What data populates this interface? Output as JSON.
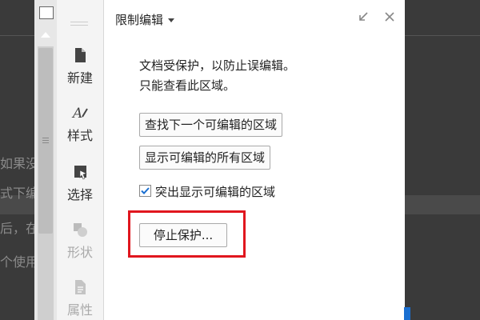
{
  "document": {
    "fragments": [
      "如果没",
      "式下编",
      "后，在",
      "个使用"
    ]
  },
  "sidebar": {
    "items": [
      {
        "label": "新建",
        "icon": "new-document-icon",
        "enabled": true
      },
      {
        "label": "样式",
        "icon": "style-icon",
        "enabled": true
      },
      {
        "label": "选择",
        "icon": "select-icon",
        "enabled": true
      },
      {
        "label": "形状",
        "icon": "shape-icon",
        "enabled": false
      },
      {
        "label": "属性",
        "icon": "properties-icon",
        "enabled": false
      }
    ]
  },
  "panel": {
    "title": "限制编辑",
    "description_line1": "文档受保护，以防止误编辑。",
    "description_line2": "只能查看此区域。",
    "find_next_label": "查找下一个可编辑的区域",
    "show_all_label": "显示可编辑的所有区域",
    "highlight_label": "突出显示可编辑的区域",
    "highlight_checked": true,
    "stop_protection_label": "停止保护..."
  },
  "colors": {
    "accent_red": "#e0161e",
    "accent_blue": "#1a6fd1"
  }
}
